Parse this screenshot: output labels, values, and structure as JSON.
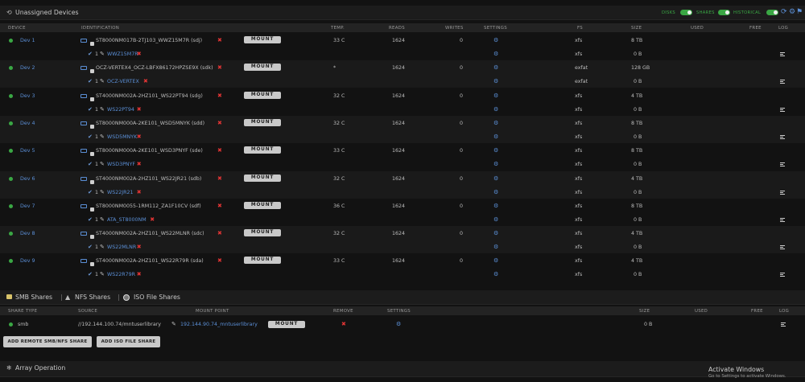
{
  "unassigned": {
    "title": "Unassigned Devices",
    "toggles": [
      {
        "label": "DISKS"
      },
      {
        "label": "SHARES"
      },
      {
        "label": "HISTORICAL"
      }
    ],
    "columns": [
      "DEVICE",
      "IDENTIFICATION",
      "TEMP.",
      "READS",
      "WRITES",
      "SETTINGS",
      "FS",
      "SIZE",
      "USED",
      "FREE",
      "LOG"
    ],
    "mount_label": "MOUNT",
    "devices": [
      {
        "device": "Dev 1",
        "id": "ST8000NM017B-2TJ103_WWZ15M7R (sdj)",
        "temp": "33 C",
        "reads": "1624",
        "writes": "0",
        "fs": "xfs",
        "size": "8 TB",
        "part_num": "1",
        "part_label": "WWZ15M7R",
        "part_fs": "xfs",
        "part_size": "0 B"
      },
      {
        "device": "Dev 2",
        "id": "OCZ-VERTEX4_OCZ-LBFX86172HPZSE9X (sdk)",
        "temp": "*",
        "reads": "1624",
        "writes": "0",
        "fs": "exfat",
        "size": "128 GB",
        "part_num": "1",
        "part_label": "OCZ-VERTEX",
        "part_fs": "exfat",
        "part_size": "0 B"
      },
      {
        "device": "Dev 3",
        "id": "ST4000NM002A-2HZ101_WS22PT94 (sdg)",
        "temp": "32 C",
        "reads": "1624",
        "writes": "0",
        "fs": "xfs",
        "size": "4 TB",
        "part_num": "1",
        "part_label": "WS22PT94",
        "part_fs": "xfs",
        "part_size": "0 B"
      },
      {
        "device": "Dev 4",
        "id": "ST8000NM000A-2KE101_WSD5MNYK (sdd)",
        "temp": "32 C",
        "reads": "1624",
        "writes": "0",
        "fs": "xfs",
        "size": "8 TB",
        "part_num": "1",
        "part_label": "WSD5MNYK",
        "part_fs": "xfs",
        "part_size": "0 B"
      },
      {
        "device": "Dev 5",
        "id": "ST8000NM000A-2KE101_WSD3PNYF (sde)",
        "temp": "33 C",
        "reads": "1624",
        "writes": "0",
        "fs": "xfs",
        "size": "8 TB",
        "part_num": "1",
        "part_label": "WSD3PNYF",
        "part_fs": "xfs",
        "part_size": "0 B"
      },
      {
        "device": "Dev 6",
        "id": "ST4000NM002A-2HZ101_WS22JR21 (sdb)",
        "temp": "32 C",
        "reads": "1624",
        "writes": "0",
        "fs": "xfs",
        "size": "4 TB",
        "part_num": "1",
        "part_label": "WS22JR21",
        "part_fs": "xfs",
        "part_size": "0 B"
      },
      {
        "device": "Dev 7",
        "id": "ST8000NM0055-1RM112_ZA1F10CV (sdf)",
        "temp": "36 C",
        "reads": "1624",
        "writes": "0",
        "fs": "xfs",
        "size": "8 TB",
        "part_num": "1",
        "part_label": "ATA_ST8000NM",
        "part_fs": "xfs",
        "part_size": "0 B"
      },
      {
        "device": "Dev 8",
        "id": "ST4000NM002A-2HZ101_WS22MLNR (sdc)",
        "temp": "32 C",
        "reads": "1624",
        "writes": "0",
        "fs": "xfs",
        "size": "4 TB",
        "part_num": "1",
        "part_label": "WS22MLNR",
        "part_fs": "xfs",
        "part_size": "0 B"
      },
      {
        "device": "Dev 9",
        "id": "ST4000NM002A-2HZ101_WS22R79R (sda)",
        "temp": "33 C",
        "reads": "1624",
        "writes": "0",
        "fs": "xfs",
        "size": "4 TB",
        "part_num": "1",
        "part_label": "WS22R79R",
        "part_fs": "xfs",
        "part_size": "0 B"
      }
    ]
  },
  "shares": {
    "tabs": [
      "SMB Shares",
      "NFS Shares",
      "ISO File Shares"
    ],
    "separator": "|",
    "columns": [
      "SHARE TYPE",
      "SOURCE",
      "MOUNT POINT",
      "REMOVE",
      "SETTINGS",
      "SIZE",
      "USED",
      "FREE",
      "LOG"
    ],
    "rows": [
      {
        "type": "smb",
        "source": "//192.144.100.74/mntuserlibrary",
        "mount_point": "192.144.90.74_mntuserlibrary",
        "mount_label": "MOUNT",
        "size": "0 B"
      }
    ],
    "buttons": [
      "ADD REMOTE SMB/NFS SHARE",
      "ADD ISO FILE SHARE"
    ]
  },
  "array": {
    "title": "Array Operation"
  },
  "watermark": {
    "line1": "Activate Windows",
    "line2": "Go to Settings to activate Windows."
  },
  "colors": {
    "accent_green": "#3aa744",
    "link_blue": "#5b8fd6",
    "remove_red": "#e03434"
  },
  "icons": {
    "title_unassigned": "refresh-icon",
    "smb": "folder-icon",
    "nfs": "tux-icon",
    "iso": "disc-icon",
    "array": "snowflake-icon"
  }
}
